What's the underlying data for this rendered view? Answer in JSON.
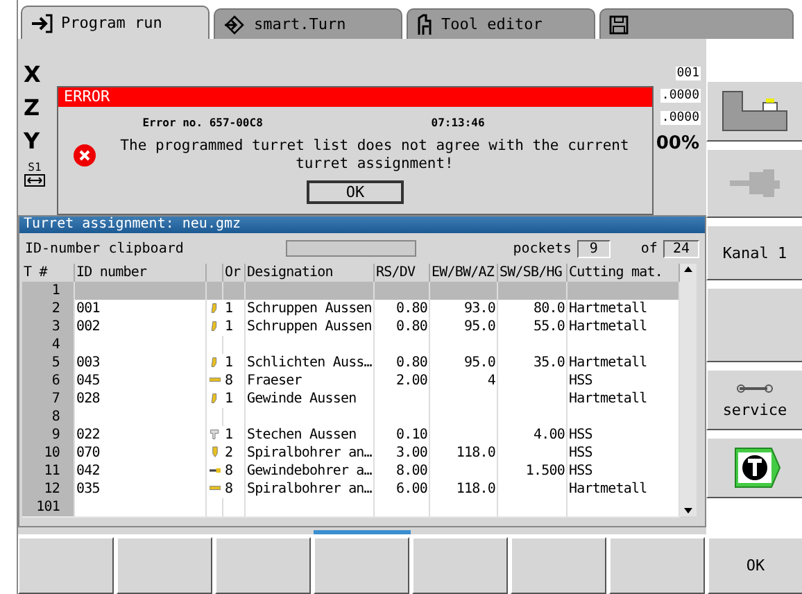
{
  "tabs": [
    {
      "label": "Program run",
      "kind": "program",
      "selected": true
    },
    {
      "label": "smart.Turn",
      "kind": "smart",
      "selected": false
    },
    {
      "label": "Tool editor",
      "kind": "tool",
      "selected": false
    },
    {
      "kind": "save",
      "selected": false
    }
  ],
  "position_display": {
    "axes": [
      "X",
      "Z",
      "Y"
    ],
    "spindle_label": "S1",
    "right_values": [
      "001",
      ".0000",
      ".0000",
      "00%"
    ]
  },
  "dialog": {
    "title": "ERROR",
    "error_number": "Error no. 657-00C8",
    "time": "07:13:46",
    "message": "The programmed turret list does not agree with the current turret assignment!",
    "button": "OK"
  },
  "turret_table": {
    "title": "Turret assignment: neu.gmz",
    "clipboard_label": "ID-number clipboard",
    "pockets_label": "pockets",
    "pockets_value": "9",
    "of_label": "of",
    "of_value": "24",
    "columns": [
      "T #",
      "ID number",
      "Or",
      "Designation",
      "RS/DV",
      "EW/BW/AZ",
      "SW/SB/HG",
      "Cutting mat."
    ],
    "rows": [
      {
        "t": "1",
        "selected": true
      },
      {
        "t": "2",
        "id": "001",
        "kind": "turning",
        "or": "1",
        "designation": "Schruppen Aussen",
        "rs": "0.80",
        "ew": "93.0",
        "sw": "80.0",
        "mat": "Hartmetall",
        "selected": false
      },
      {
        "t": "3",
        "id": "002",
        "kind": "turning",
        "or": "1",
        "designation": "Schruppen Aussen",
        "rs": "0.80",
        "ew": "95.0",
        "sw": "55.0",
        "mat": "Hartmetall",
        "selected": false
      },
      {
        "t": "4",
        "selected": false
      },
      {
        "t": "5",
        "id": "003",
        "kind": "turning",
        "or": "1",
        "designation": "Schlichten Auss…",
        "rs": "0.80",
        "ew": "95.0",
        "sw": "35.0",
        "mat": "Hartmetall",
        "selected": false
      },
      {
        "t": "6",
        "id": "045",
        "kind": "milling",
        "or": "8",
        "designation": "Fraeser",
        "rs": "2.00",
        "ew": "4",
        "mat": "HSS",
        "selected": false
      },
      {
        "t": "7",
        "id": "028",
        "kind": "turning",
        "or": "1",
        "designation": "Gewinde Aussen",
        "mat": "Hartmetall",
        "selected": false
      },
      {
        "t": "8",
        "selected": false
      },
      {
        "t": "9",
        "id": "022",
        "kind": "grooving",
        "or": "1",
        "designation": "Stechen Aussen",
        "rs": "0.10",
        "sw": "4.00",
        "mat": "HSS",
        "selected": false
      },
      {
        "t": "10",
        "id": "070",
        "kind": "drilling",
        "or": "2",
        "designation": "Spiralbohrer an…",
        "rs": "3.00",
        "ew": "118.0",
        "mat": "HSS",
        "selected": false
      },
      {
        "t": "11",
        "id": "042",
        "kind": "tapping",
        "or": "8",
        "designation": "Gewindebohrer a…",
        "rs": "8.00",
        "sw": "1.500",
        "mat": "HSS",
        "selected": false
      },
      {
        "t": "12",
        "id": "035",
        "kind": "milling",
        "or": "8",
        "designation": "Spiralbohrer an…",
        "rs": "6.00",
        "ew": "118.0",
        "mat": "Hartmetall",
        "selected": false
      },
      {
        "t": "101",
        "selected": false
      }
    ]
  },
  "right_softkeys": [
    {
      "kind": "machine"
    },
    {
      "kind": "disabled"
    },
    {
      "kind": "text",
      "label": "Kanal 1"
    },
    {
      "kind": "blank"
    },
    {
      "kind": "service",
      "label": "service"
    },
    {
      "kind": "turret"
    }
  ],
  "bottom_softkeys": [
    {
      "kind": "blank"
    },
    {
      "kind": "blank"
    },
    {
      "kind": "blank"
    },
    {
      "kind": "blank"
    },
    {
      "kind": "blank"
    },
    {
      "kind": "blank"
    },
    {
      "kind": "blank"
    },
    {
      "kind": "text",
      "label": "OK"
    }
  ]
}
